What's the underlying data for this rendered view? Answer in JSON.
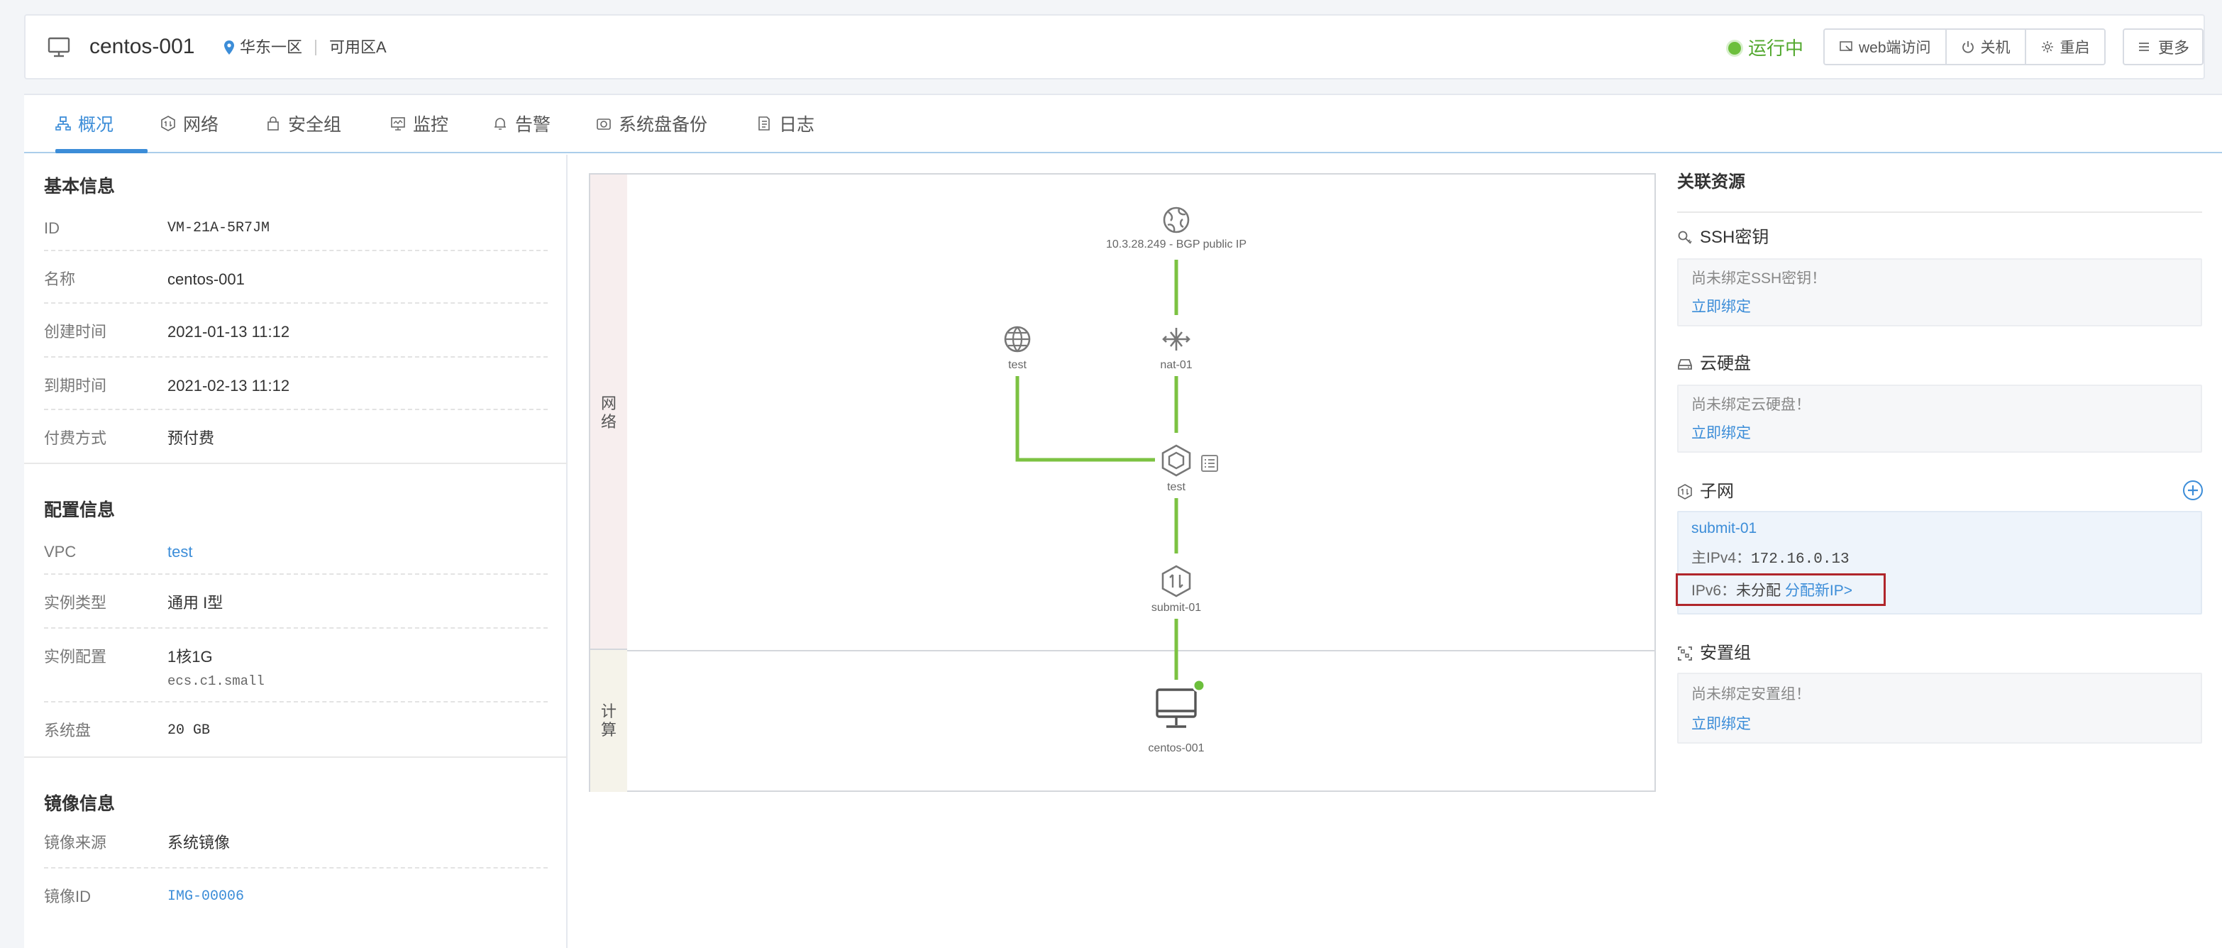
{
  "header": {
    "instance_name": "centos-001",
    "region": "华东一区",
    "zone": "可用区A",
    "status": "运行中",
    "buttons": {
      "web": "web端访问",
      "shutdown": "关机",
      "restart": "重启",
      "more": "更多"
    }
  },
  "tabs": [
    {
      "label": "概况"
    },
    {
      "label": "网络"
    },
    {
      "label": "安全组"
    },
    {
      "label": "监控"
    },
    {
      "label": "告警"
    },
    {
      "label": "系统盘备份"
    },
    {
      "label": "日志"
    }
  ],
  "basic": {
    "title": "基本信息",
    "rows": [
      {
        "key": "ID",
        "value": "VM-21A-5R7JM"
      },
      {
        "key": "名称",
        "value": "centos-001"
      },
      {
        "key": "创建时间",
        "value": "2021-01-13 11:12"
      },
      {
        "key": "到期时间",
        "value": "2021-02-13 11:12"
      },
      {
        "key": "付费方式",
        "value": "预付费"
      }
    ]
  },
  "config": {
    "title": "配置信息",
    "rows": [
      {
        "key": "VPC",
        "value": "test"
      },
      {
        "key": "实例类型",
        "value": "通用 I型"
      },
      {
        "key": "实例配置",
        "value": "1核1G",
        "sub": "ecs.c1.small"
      },
      {
        "key": "系统盘",
        "value": "20 GB"
      }
    ]
  },
  "image": {
    "title": "镜像信息",
    "rows": [
      {
        "key": "镜像来源",
        "value": "系统镜像"
      },
      {
        "key": "镜像ID",
        "value": "IMG-00006"
      }
    ]
  },
  "topology": {
    "lanes": {
      "network": "网络",
      "compute": "计算"
    },
    "nodes": {
      "public_ip": "10.3.28.249 - BGP public IP",
      "internet": "test",
      "nat": "nat-01",
      "vpc": "test",
      "subnet": "submit-01",
      "instance": "centos-001"
    }
  },
  "related": {
    "title": "关联资源",
    "ssh": {
      "title": "SSH密钥",
      "msg": "尚未绑定SSH密钥！",
      "link": "立即绑定"
    },
    "disk": {
      "title": "云硬盘",
      "msg": "尚未绑定云硬盘！",
      "link": "立即绑定"
    },
    "subnet": {
      "title": "子网",
      "name": "submit-01",
      "ipv4_label": "主IPv4：",
      "ipv4": "172.16.0.13",
      "ipv6_label": "IPv6：",
      "ipv6_value": "未分配",
      "ipv6_link": "分配新IP>"
    },
    "placement": {
      "title": "安置组",
      "msg": "尚未绑定安置组！",
      "link": "立即绑定"
    }
  },
  "colors": {
    "accent": "#3c8dd8",
    "running": "#52a82e",
    "link_line": "#7cc242",
    "highlight": "#b0262b"
  }
}
